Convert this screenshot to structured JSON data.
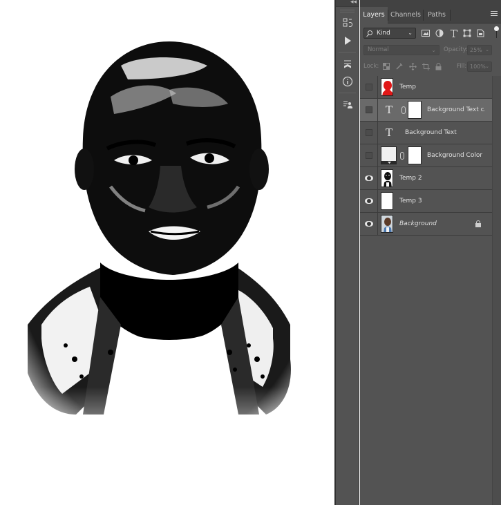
{
  "tool_strip": {
    "icons": [
      "history-icon",
      "play-action-icon",
      "properties-cube-icon",
      "info-icon",
      "clone-source-icon"
    ]
  },
  "panel": {
    "collapse_glyph": "◂◂",
    "tabs": [
      {
        "label": "Layers",
        "active": true
      },
      {
        "label": "Channels",
        "active": false
      },
      {
        "label": "Paths",
        "active": false
      }
    ],
    "filter": {
      "kind_label": "Kind",
      "arrow": "⌄"
    },
    "blend_mode": "Normal",
    "opacity_label": "Opacity:",
    "opacity_value": "25%",
    "lock_label": "Lock:",
    "fill_label": "Fill:",
    "fill_value": "100%"
  },
  "layers": [
    {
      "name": "Temp",
      "visible": false,
      "thumb": "red-silhouette",
      "selected": false,
      "italic": false
    },
    {
      "name": "Background Text c...",
      "visible": false,
      "thumb": "type-with-mask",
      "selected": true,
      "italic": false
    },
    {
      "name": "Background Text",
      "visible": false,
      "thumb": "type",
      "selected": false,
      "italic": false
    },
    {
      "name": "Background Color",
      "visible": false,
      "thumb": "fill-with-mask",
      "selected": false,
      "italic": false
    },
    {
      "name": "Temp 2",
      "visible": true,
      "thumb": "bw-portrait",
      "selected": false,
      "italic": false
    },
    {
      "name": "Temp 3",
      "visible": true,
      "thumb": "white",
      "selected": false,
      "italic": false
    },
    {
      "name": "Background",
      "visible": true,
      "thumb": "color-portrait",
      "selected": false,
      "italic": true,
      "locked": true
    }
  ],
  "colors": {
    "panel_bg": "#535353",
    "panel_dark": "#424242",
    "selected_layer": "#6a6a6a",
    "mask_red": "#e01818"
  }
}
